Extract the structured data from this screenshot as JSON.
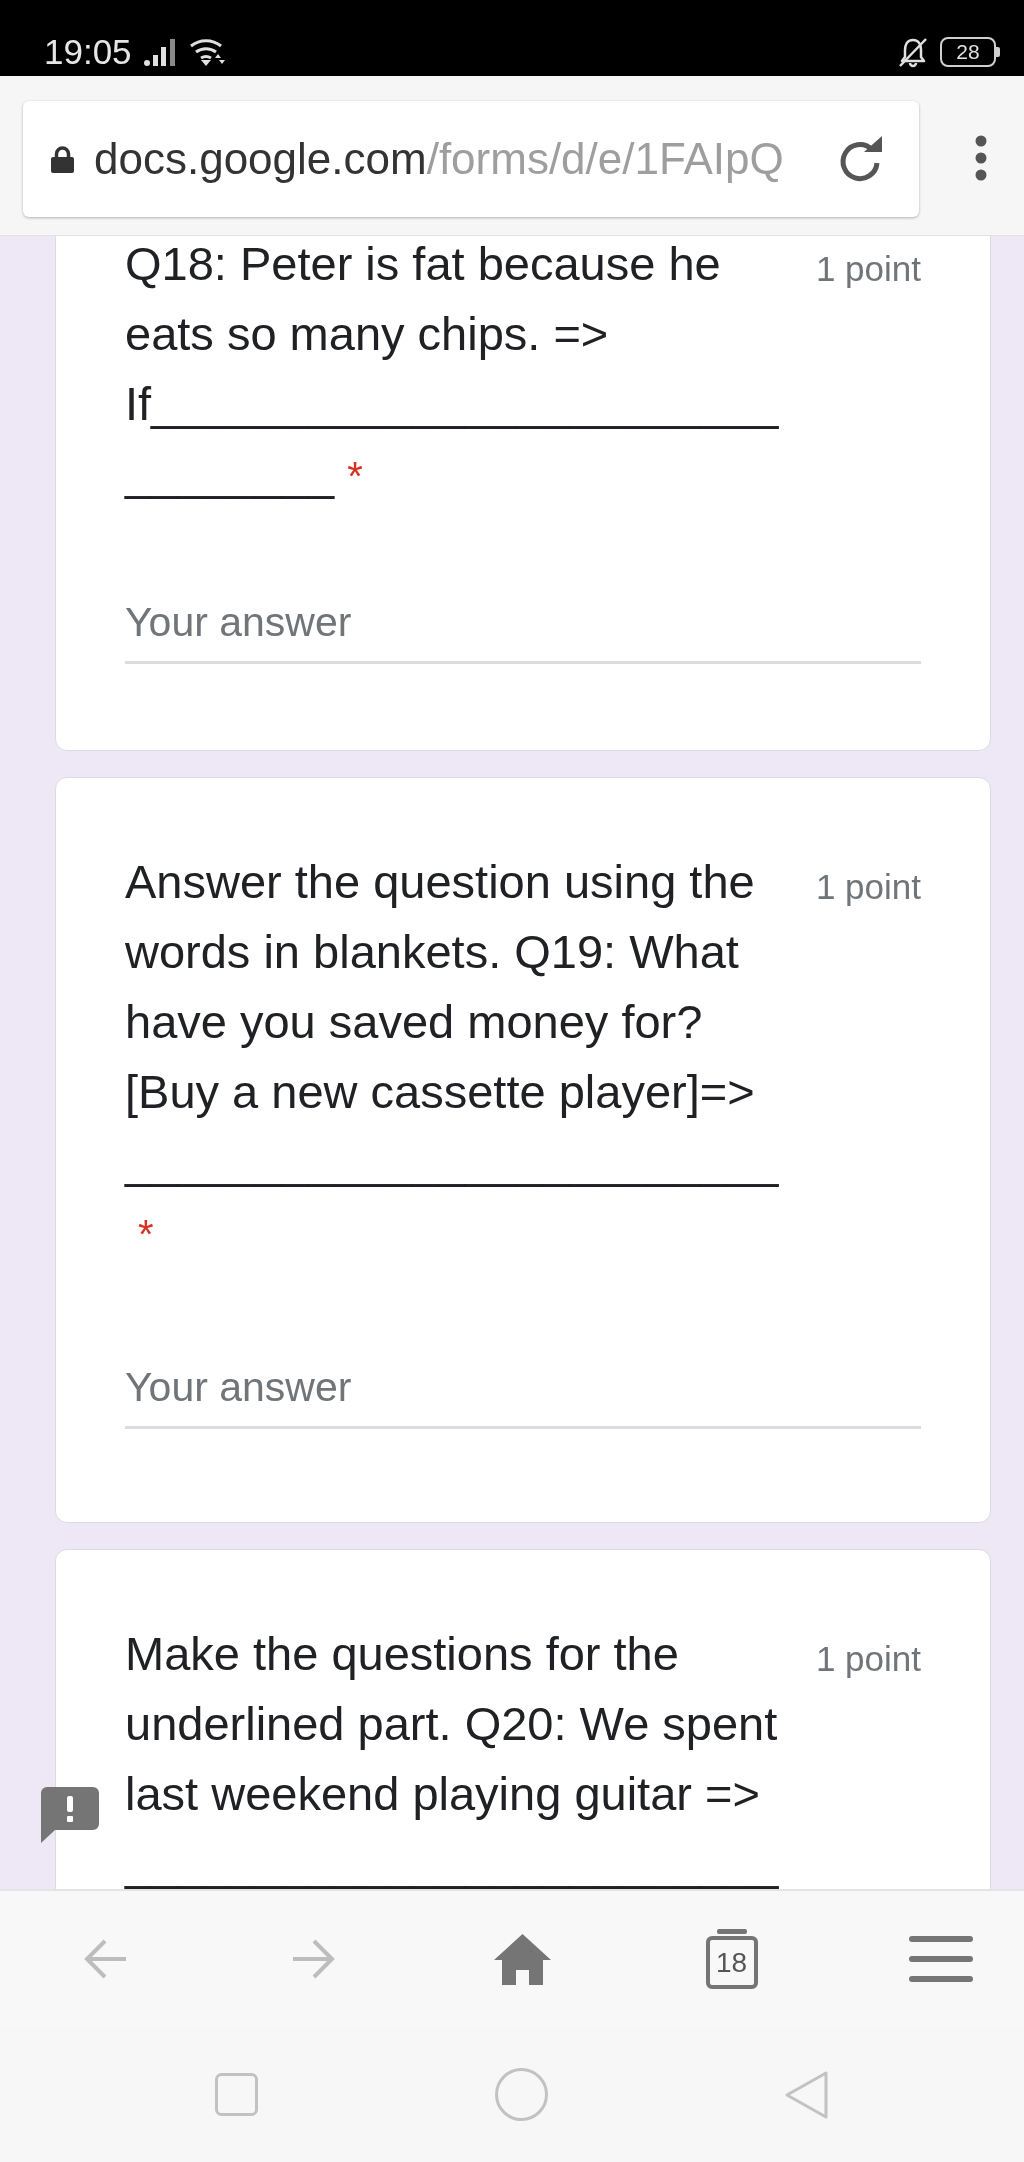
{
  "status_bar": {
    "time": "19:05",
    "battery": "28"
  },
  "browser": {
    "url_domain": "docs.google.com",
    "url_path": "/forms/d/e/1FAIpQ"
  },
  "questions": [
    {
      "title": "Q18: Peter is fat because he eats so many chips. => If________________________________",
      "required_mark": "*",
      "points": "1 point",
      "placeholder": "Your answer"
    },
    {
      "title": "Answer the question using the words in blankets. Q19: What have you saved money for? [Buy a new cassette player]=> _________________________",
      "required_mark": "*",
      "points": "1 point",
      "placeholder": "Your answer"
    },
    {
      "title": "Make the questions for the underlined part. Q20: We spent last weekend playing guitar => _________________________",
      "points": "1 point"
    }
  ],
  "bottom_bar": {
    "tab_count": "18"
  }
}
